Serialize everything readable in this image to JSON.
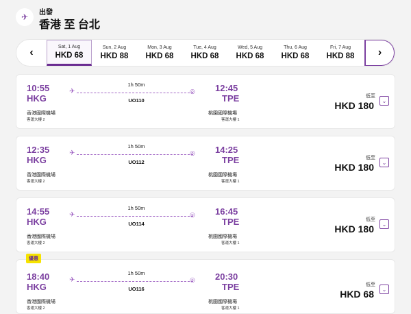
{
  "header": {
    "subtitle": "出發",
    "title": "香港 至 台北",
    "icon": "plane-departure-icon"
  },
  "dates": [
    {
      "day": "Sat, 1 Aug",
      "price": "HKD 68",
      "selected": true
    },
    {
      "day": "Sun, 2 Aug",
      "price": "HKD 88"
    },
    {
      "day": "Mon, 3 Aug",
      "price": "HKD 68"
    },
    {
      "day": "Tue, 4 Aug",
      "price": "HKD 68"
    },
    {
      "day": "Wed, 5 Aug",
      "price": "HKD 68"
    },
    {
      "day": "Thu, 6 Aug",
      "price": "HKD 68"
    },
    {
      "day": "Fri, 7 Aug",
      "price": "HKD 88"
    }
  ],
  "nav": {
    "prev": "‹",
    "next": "›"
  },
  "flights": [
    {
      "dep": "10:55",
      "from": "HKG",
      "arr": "12:45",
      "to": "TPE",
      "duration": "1h 50m",
      "flight": "UO110",
      "from_airport": "香港國際機場",
      "from_term": "客運大樓 2",
      "to_airport": "桃園國際機場",
      "to_term": "客運大樓 1",
      "from_label": "低至",
      "price": "HKD 180"
    },
    {
      "dep": "12:35",
      "from": "HKG",
      "arr": "14:25",
      "to": "TPE",
      "duration": "1h 50m",
      "flight": "UO112",
      "from_airport": "香港國際機場",
      "from_term": "客運大樓 2",
      "to_airport": "桃園國際機場",
      "to_term": "客運大樓 1",
      "from_label": "低至",
      "price": "HKD 180"
    },
    {
      "dep": "14:55",
      "from": "HKG",
      "arr": "16:45",
      "to": "TPE",
      "duration": "1h 50m",
      "flight": "UO114",
      "from_airport": "香港國際機場",
      "from_term": "客運大樓 2",
      "to_airport": "桃園國際機場",
      "to_term": "客運大樓 1",
      "from_label": "低至",
      "price": "HKD 180"
    },
    {
      "dep": "18:40",
      "from": "HKG",
      "arr": "20:30",
      "to": "TPE",
      "duration": "1h 50m",
      "flight": "UO116",
      "from_airport": "香港國際機場",
      "from_term": "客運大樓 2",
      "to_airport": "桃園國際機場",
      "to_term": "客運大樓 1",
      "from_label": "低至",
      "price": "HKD 68",
      "badge": "優惠"
    }
  ]
}
